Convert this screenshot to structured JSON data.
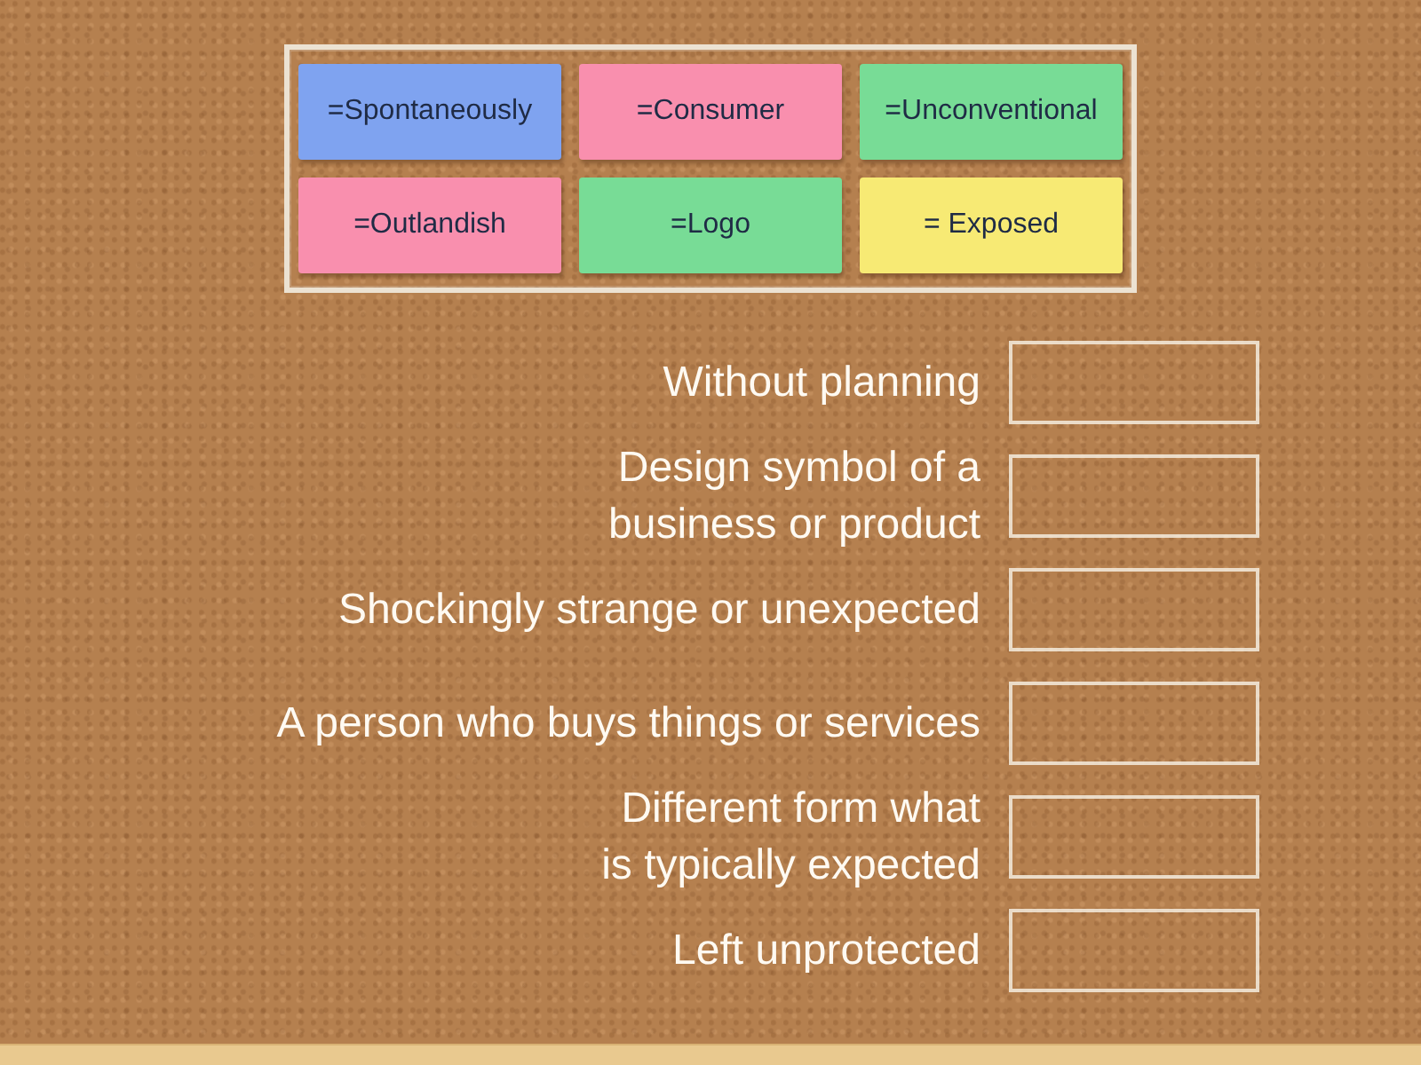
{
  "cards": [
    {
      "text": "=Spontaneously",
      "color": "#7fa3f0"
    },
    {
      "text": "=Consumer",
      "color": "#f98fae"
    },
    {
      "text": "=Unconventional",
      "color": "#78dc96"
    },
    {
      "text": "=Outlandish",
      "color": "#f98fae"
    },
    {
      "text": "=Logo",
      "color": "#78dc96"
    },
    {
      "text": "= Exposed",
      "color": "#f7ea74"
    }
  ],
  "prompts": [
    {
      "lines": [
        "Without planning"
      ]
    },
    {
      "lines": [
        "Design symbol of a",
        "business or product"
      ]
    },
    {
      "lines": [
        "Shockingly strange or unexpected"
      ]
    },
    {
      "lines": [
        "A person who buys things or services"
      ]
    },
    {
      "lines": [
        "Different form what",
        "is typically expected"
      ]
    },
    {
      "lines": [
        "Left unprotected"
      ]
    }
  ]
}
